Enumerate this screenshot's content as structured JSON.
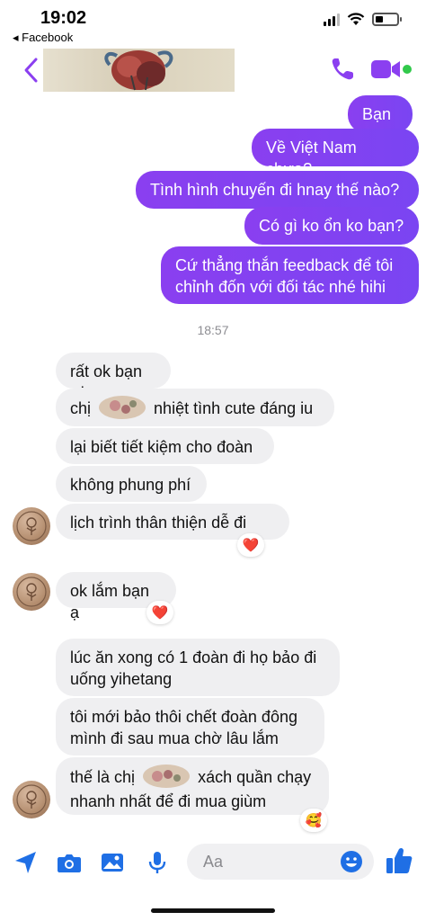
{
  "status_bar": {
    "time": "19:02",
    "back_app": "◂ Facebook"
  },
  "header": {
    "accent": "#8b3ff0",
    "online_color": "#31c94b"
  },
  "timestamp": "18:57",
  "messages_out": [
    "Bạn ơi",
    "Về Việt Nam chưa?",
    "Tình hình chuyến đi hnay thế nào?",
    "Có gì ko ổn ko bạn?",
    "Cứ thẳng thắn feedback để tôi chỉnh đốn với đối tác nhé hihi"
  ],
  "messages_in": {
    "m1": "rất ok bạn ơi",
    "m2_a": "chị",
    "m2_b": "nhiệt tình cute đáng iu",
    "m3": "lại biết tiết kiệm cho đoàn",
    "m4": "không phung phí",
    "m5": "lịch trình thân thiện dễ đi",
    "m6": "ok lắm bạn ạ",
    "m7": "lúc ăn xong có 1 đoàn đi họ bảo đi uống yihetang",
    "m8": "tôi mới bảo thôi chết đoàn đông mình đi sau mua chờ lâu lắm",
    "m9_a": "thế là chị",
    "m9_b": "xách quần chạy nhanh nhất để đi mua giùm"
  },
  "reactions": {
    "r1": "❤️",
    "r2": "❤️",
    "r3": "🥰"
  },
  "composer": {
    "placeholder": "Aa"
  }
}
